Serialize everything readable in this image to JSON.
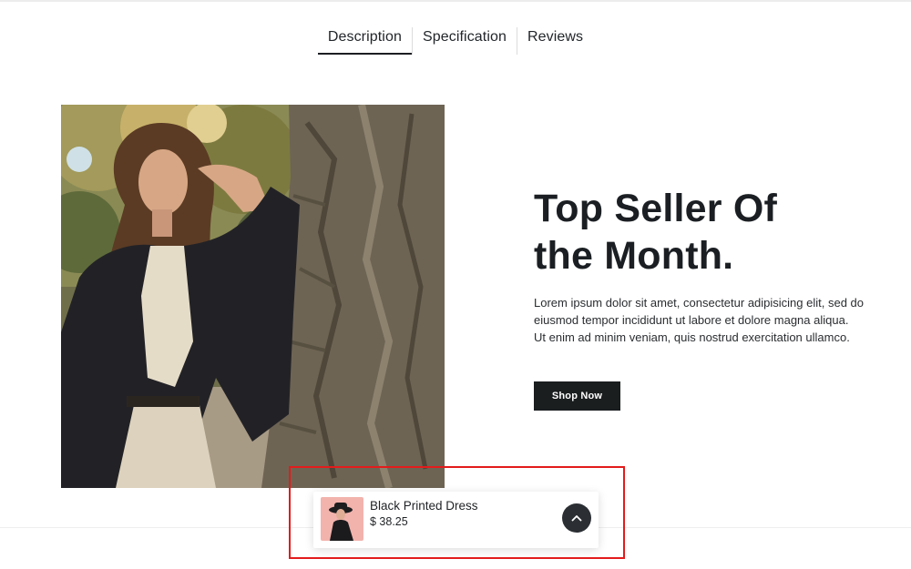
{
  "tabs": [
    {
      "label": "Description",
      "active": true
    },
    {
      "label": "Specification",
      "active": false
    },
    {
      "label": "Reviews",
      "active": false
    }
  ],
  "hero": {
    "heading_line1": "Top Seller Of",
    "heading_line2": "the Month.",
    "body": "Lorem ipsum dolor sit amet, consectetur adipisicing elit, sed do eiusmod tempor incididunt ut labore et dolore magna aliqua. Ut enim ad minim veniam, quis nostrud exercitation ullamco.",
    "cta_label": "Shop Now"
  },
  "sticky_cart": {
    "product_name": "Black Printed Dress",
    "price": "$ 38.25",
    "icon": "chevron-up-icon"
  },
  "colors": {
    "button_bg": "#1a1e1f",
    "highlight": "#e31b1b",
    "thumb_bg": "#f2b3ad"
  }
}
